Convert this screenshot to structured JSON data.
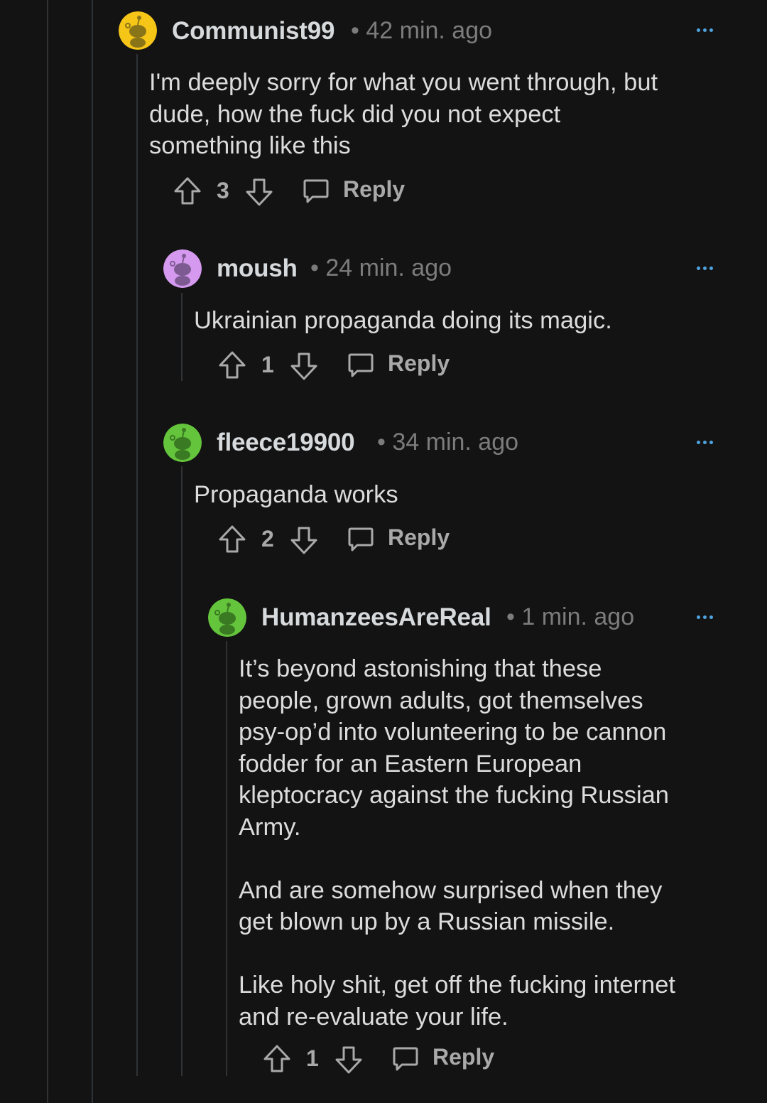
{
  "comments": [
    {
      "username": "Communist99",
      "time": "42 min. ago",
      "avatar_color": "#f5c518",
      "body_lines": [
        "I'm deeply sorry for what you went through, but",
        "dude, how the fuck did you not expect",
        "something like this"
      ],
      "votes": "3",
      "reply_label": "Reply"
    },
    {
      "username": "moush",
      "time": "24 min. ago",
      "avatar_color": "#d59af0",
      "body_lines": [
        "Ukrainian propaganda doing its magic."
      ],
      "votes": "1",
      "reply_label": "Reply"
    },
    {
      "username": "fleece19900",
      "time": "34 min. ago",
      "avatar_color": "#64c43c",
      "body_lines": [
        "Propaganda works"
      ],
      "votes": "2",
      "reply_label": "Reply"
    },
    {
      "username": "HumanzeesAreReal",
      "time": "1 min. ago",
      "avatar_color": "#64c43c",
      "paragraphs": [
        [
          "It’s beyond astonishing that these",
          "people, grown adults, got themselves",
          "psy-op’d into volunteering to be cannon",
          "fodder for an Eastern European",
          "kleptocracy against the fucking Russian",
          "Army."
        ],
        [
          "And are somehow surprised when they",
          "get blown up by a Russian missile."
        ],
        [
          "Like holy shit, get off the fucking internet",
          "and re-evaluate your life."
        ]
      ],
      "votes": "1",
      "reply_label": "Reply"
    }
  ],
  "separator": "•",
  "icons": {
    "upvote": "arrow-up-outline-icon",
    "downvote": "arrow-down-outline-icon",
    "reply": "speech-bubble-icon",
    "more": "three-dots-icon",
    "avatar": "reddit-snoo-icon"
  },
  "colors": {
    "background": "#131313",
    "text": "#d7dadc",
    "meta": "#7c7c7c",
    "more_dots": "#4fa3e0",
    "thread_line": "#2f3336"
  }
}
